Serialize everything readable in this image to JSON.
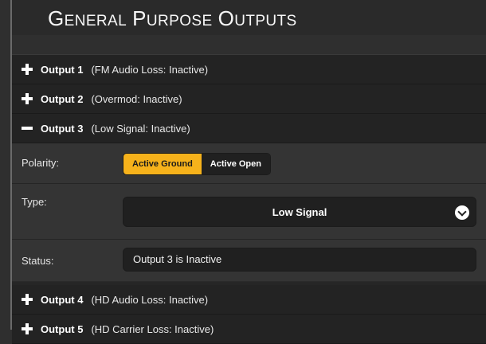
{
  "page": {
    "title_first": "G",
    "title_rest": "ENERAL",
    "title_word2_first": "P",
    "title_word2_rest": "URPOSE",
    "title_word3_first": "O",
    "title_word3_rest": "UTPUTS"
  },
  "outputs": [
    {
      "name": "Output 1",
      "status": "(FM Audio Loss: Inactive)",
      "expanded": false
    },
    {
      "name": "Output 2",
      "status": "(Overmod: Inactive)",
      "expanded": false
    },
    {
      "name": "Output 3",
      "status": "(Low Signal: Inactive)",
      "expanded": true
    },
    {
      "name": "Output 4",
      "status": "(HD Audio Loss: Inactive)",
      "expanded": false
    },
    {
      "name": "Output 5",
      "status": "(HD Carrier Loss: Inactive)",
      "expanded": false
    }
  ],
  "detail": {
    "polarity_label": "Polarity:",
    "polarity_options": [
      "Active Ground",
      "Active Open"
    ],
    "polarity_selected": "Active Ground",
    "type_label": "Type:",
    "type_value": "Low Signal",
    "status_label": "Status:",
    "status_value": "Output 3 is Inactive"
  },
  "colors": {
    "accent": "#f6b21b",
    "background": "#2f2f2f"
  }
}
